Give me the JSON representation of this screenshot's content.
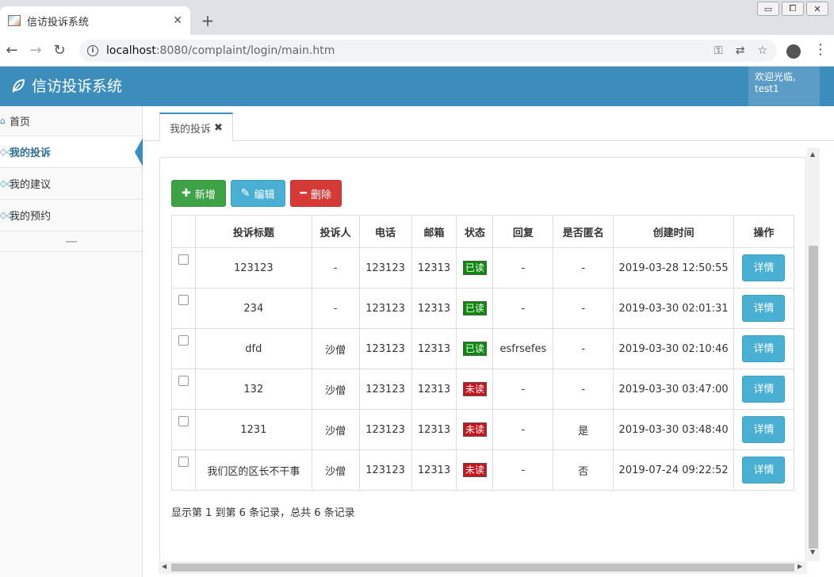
{
  "browser": {
    "tab_title": "信访投诉系统",
    "tab_close": "✕",
    "new_tab": "+",
    "url_host": "localhost",
    "url_rest": ":8080/complaint/login/main.htm",
    "info_icon": "i",
    "window_controls": [
      "▭",
      "⧠",
      "✕"
    ]
  },
  "header": {
    "app_title": "信访投诉系统",
    "welcome": "欢迎光临,",
    "username": "test1"
  },
  "sidebar": {
    "items": [
      {
        "label": "首页",
        "icon": "⌂",
        "active": false
      },
      {
        "label": "我的投诉",
        "icon": "◇◇",
        "active": true
      },
      {
        "label": "我的建议",
        "icon": "◇◇",
        "active": false
      },
      {
        "label": "我的预约",
        "icon": "◇◇",
        "active": false
      }
    ]
  },
  "content_tab": {
    "label": "我的投诉",
    "close": "✖"
  },
  "toolbar": {
    "add_label": "新增",
    "edit_label": "编辑",
    "delete_label": "删除"
  },
  "table": {
    "headers": [
      "投诉标题",
      "投诉人",
      "电话",
      "邮箱",
      "状态",
      "回复",
      "是否匿名",
      "创建时间",
      "操作"
    ],
    "detail_label": "详情",
    "rows": [
      {
        "title": "123123",
        "person": "-",
        "phone": "123123",
        "email": "12313",
        "status": "已读",
        "reply": "-",
        "anon": "-",
        "created": "2019-03-28 12:50:55"
      },
      {
        "title": "234",
        "person": "-",
        "phone": "123123",
        "email": "12313",
        "status": "已读",
        "reply": "-",
        "anon": "-",
        "created": "2019-03-30 02:01:31"
      },
      {
        "title": "dfd",
        "person": "沙僧",
        "phone": "123123",
        "email": "12313",
        "status": "已读",
        "reply": "esfrsefes",
        "anon": "-",
        "created": "2019-03-30 02:10:46"
      },
      {
        "title": "132",
        "person": "沙僧",
        "phone": "123123",
        "email": "12313",
        "status": "未读",
        "reply": "-",
        "anon": "-",
        "created": "2019-03-30 03:47:00"
      },
      {
        "title": "1231",
        "person": "沙僧",
        "phone": "123123",
        "email": "12313",
        "status": "未读",
        "reply": "-",
        "anon": "是",
        "created": "2019-03-30 03:48:40"
      },
      {
        "title": "我们区的区长不干事",
        "person": "沙僧",
        "phone": "123123",
        "email": "12313",
        "status": "未读",
        "reply": "-",
        "anon": "否",
        "created": "2019-07-24 09:22:52"
      }
    ]
  },
  "pagination_info": "显示第 1 到第 6 条记录，总共 6 条记录",
  "colors": {
    "header_bg": "#3c8dbc",
    "read_badge": "#0a8a0a",
    "unread_badge": "#c8141e",
    "add_btn": "#3ea346",
    "edit_btn": "#49b0d4",
    "delete_btn": "#d63a36"
  }
}
